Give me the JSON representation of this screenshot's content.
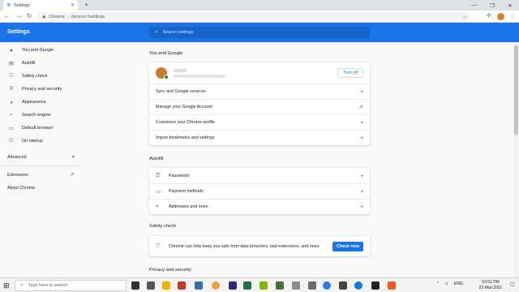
{
  "browser": {
    "tab_title": "Settings",
    "new_tab": "+",
    "address_host": "Chrome",
    "address_separator": "|",
    "address_url": "chrome://settings",
    "minimize": "—",
    "maximize": "❐",
    "close": "✕"
  },
  "header": {
    "title": "Settings",
    "search_placeholder": "Search settings"
  },
  "sidebar": {
    "items": [
      {
        "label": "You and Google",
        "icon": "person-icon"
      },
      {
        "label": "Autofill",
        "icon": "clipboard-icon"
      },
      {
        "label": "Safety check",
        "icon": "shield-icon"
      },
      {
        "label": "Privacy and security",
        "icon": "shield-lock-icon"
      },
      {
        "label": "Appearance",
        "icon": "palette-icon"
      },
      {
        "label": "Search engine",
        "icon": "search-icon"
      },
      {
        "label": "Default browser",
        "icon": "browser-icon"
      },
      {
        "label": "On startup",
        "icon": "power-icon"
      }
    ],
    "advanced": "Advanced",
    "extensions": "Extensions",
    "about": "About Chrome"
  },
  "you_and_google": {
    "title": "You and Google",
    "turn_off": "Turn off",
    "rows": [
      "Sync and Google services",
      "Manage your Google Account",
      "Customize your Chrome profile",
      "Import bookmarks and settings"
    ]
  },
  "autofill": {
    "title": "Autofill",
    "rows": [
      "Passwords",
      "Payment methods",
      "Addresses and more"
    ]
  },
  "safety_check": {
    "title": "Safety check",
    "message": "Chrome can help keep you safe from data breaches, bad extensions, and more",
    "button": "Check now"
  },
  "privacy": {
    "title": "Privacy and security"
  },
  "taskbar": {
    "search_placeholder": "Type here to search",
    "language": "ENG",
    "time": "03:51 PM",
    "date": "22-Mar-2021"
  }
}
